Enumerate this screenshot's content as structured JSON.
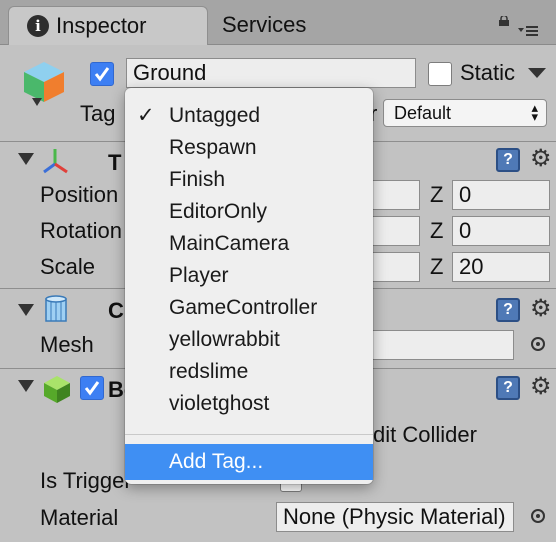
{
  "tabs": {
    "inspector": "Inspector",
    "services": "Services"
  },
  "object": {
    "name": "Ground",
    "static_label": "Static",
    "tag_label": "Tag",
    "layer_label_tail": "r",
    "layer_value": "Default"
  },
  "transform": {
    "title": "T",
    "labels": {
      "position": "Position",
      "rotation": "Rotation",
      "scale": "Scale"
    },
    "z_axis": "Z",
    "z_values": [
      "0",
      "0",
      "20"
    ]
  },
  "mesh_filter": {
    "title": "C",
    "mesh_label": "Mesh"
  },
  "box_collider": {
    "title": "Bo",
    "edit_collider_fragment": "dit Collider",
    "is_trigger_label": "Is Trigger",
    "material_label": "Material",
    "material_value": "None (Physic Material)"
  },
  "tag_menu": {
    "selected": "Untagged",
    "items": [
      "Untagged",
      "Respawn",
      "Finish",
      "EditorOnly",
      "MainCamera",
      "Player",
      "GameController",
      "yellowrabbit",
      "redslime",
      "violetghost"
    ],
    "add_tag": "Add Tag...",
    "checkmark": "✓"
  },
  "colors": {
    "menu_highlight": "#3f8ff3",
    "checkbox_blue": "#3d7ff3",
    "panel_bg": "#c2c2c2"
  },
  "icons": [
    "info-icon",
    "lock-icon",
    "tab-menu-icon",
    "cube-icon",
    "transform-axes-icon",
    "mesh-icon",
    "box-collider-icon",
    "help-icon",
    "gear-icon",
    "target-icon"
  ]
}
